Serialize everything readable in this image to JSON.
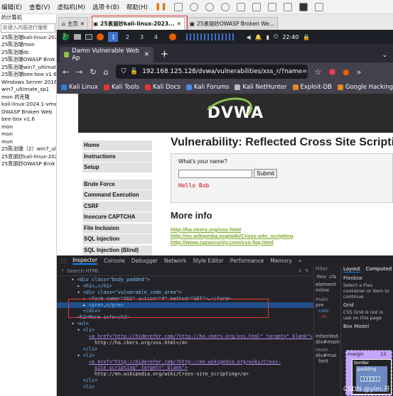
{
  "vmware": {
    "menu": [
      "编辑(E)",
      "查看(V)",
      "虚拟机(M)",
      "选项卡(B)",
      "帮助(H)"
    ],
    "library": {
      "title": "的计算机",
      "search_placeholder": "处键入内容进行搜索",
      "items": [
        "25陈治瑞kali-linux-202",
        "25陈治瑞mon",
        "25陈治瑞dc",
        "25陈治瑞OWASP Brok",
        "25陈治瑞win7_ultimate",
        "25陈治瑞bee-box v1.6",
        "Windows Server 2016",
        "win7_ultimate_sp1",
        "mon 的克隆",
        "kali-linux-2024.1-vmw",
        "OWASP Broken Web",
        "bee-box v1.6",
        "mon",
        "mon",
        "mon",
        "25陈治瑞（2）win7_ult",
        "25袁丽妙kali-linux-202",
        "25袁丽妙OWASP Brok"
      ]
    },
    "tabs": [
      {
        "label": "主页",
        "active": false
      },
      {
        "label": "25袁丽妙kali-linux-2023...",
        "active": true
      },
      {
        "label": "25袁丽妙OWASP Broken We...",
        "active": false
      }
    ]
  },
  "kali_panel": {
    "workspaces": [
      "1",
      "2",
      "3",
      "4"
    ],
    "active_workspace": "1",
    "clock": "22:40"
  },
  "firefox": {
    "tab_title": "Damn Vulnerable Web Ap",
    "url": "192.168.125.128/dvwa/vulnerabilities/xss_r/?name=Bob<",
    "bookmarks": [
      "Kali Linux",
      "Kali Tools",
      "Kali Docs",
      "Kali Forums",
      "Kali NetHunter",
      "Exploit-DB",
      "Google Hacking DB"
    ]
  },
  "dvwa": {
    "logo": "DVWA",
    "menu": [
      "Home",
      "Instructions",
      "Setup",
      "",
      "Brute Force",
      "Command Execution",
      "CSRF",
      "Insecure CAPTCHA",
      "File Inclusion",
      "SQL Injection",
      "SQL Injection (Blind)"
    ],
    "title": "Vulnerability: Reflected Cross Site Scripting",
    "prompt": "What's your name?",
    "submit": "Submit",
    "output": "Hello Bob",
    "more_info": "More info",
    "links": [
      "http://ha.ckers.org/xss.html",
      "http://en.wikipedia.org/wiki/Cross-site_scripting",
      "http://www.cgisecurity.com/xss-faq.html"
    ]
  },
  "devtools": {
    "tabs": [
      "Inspector",
      "Console",
      "Debugger",
      "Network",
      "Style Editor",
      "Performance",
      "Memory"
    ],
    "search_placeholder": "Search HTML",
    "tree": [
      "<div class=\"body_padded\">",
      "<h1>…</h1>",
      "<div class=\"vulnerable_code_area\">",
      "<form name=\"XSS\" action=\"#\" method=\"GET\">…</form>",
      "<pre>…</pre>",
      "</div>",
      "<h2>More info</h2>",
      "<ul>",
      "<li>",
      "<a href=\"http://hiderefer.com/?http://ha.ckers.org/xss.html\" target=\"_blank\">",
      "http://ha.ckers.org/xss.html</a>",
      "</li>",
      "<li>",
      "<a href=\"http://hiderefer.com/?http://en.wikipedia.org/wiki/Cross-",
      "site_scripting\" target=\"_blank\">",
      "http://en.wikipedia.org/wiki/Cross-site_scripting</a>",
      "</li>",
      "<li>"
    ],
    "rules": {
      "filter": "Filter",
      "hov": ":hov .cls",
      "element": "element",
      "inline": "inline",
      "main": "main.",
      "pre": "pre",
      "colo": "colo",
      "re": "re",
      "inherited": "Inherited",
      "div_main": "div#main",
      "main_css": "main.",
      "div_main2": "div#mai",
      "font": "font"
    },
    "layout": {
      "tabs": [
        "Layout",
        "Computed"
      ],
      "flexbox": "Flexbox",
      "flex_msg": "Select a Flex container or item to continue.",
      "grid": "Grid",
      "grid_msg": "CSS Grid is not in use on this page",
      "box_model": "Box Model",
      "margin": "margin",
      "margin_val": "13",
      "border": "border",
      "padding": "padding",
      "size": "611×15"
    }
  },
  "watermark": "CSDN @ylm.开"
}
